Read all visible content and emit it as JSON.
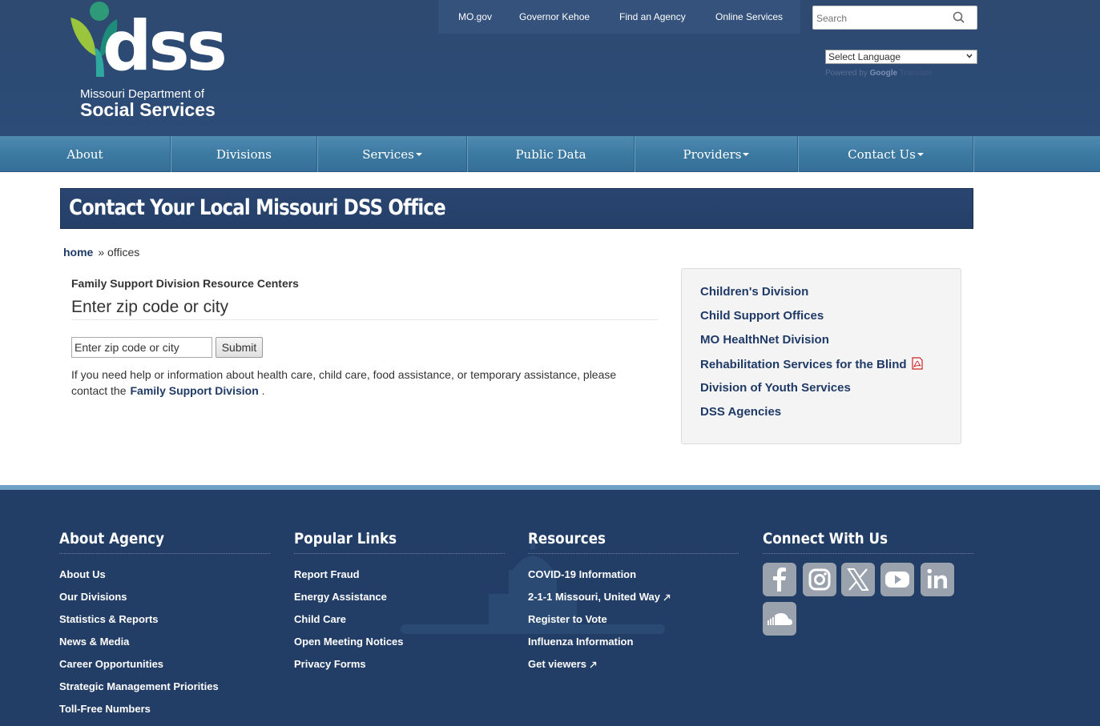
{
  "header": {
    "logo_word": "dss",
    "logo_line1": "Missouri Department of",
    "logo_line2": "Social Services",
    "util_links": [
      "MO.gov",
      "Governor Kehoe",
      "Find an Agency",
      "Online Services"
    ],
    "search_placeholder": "Search",
    "language_select": "Select Language",
    "powered_by": "Powered by",
    "powered_brand": "Google",
    "powered_suffix": "Translate"
  },
  "nav": {
    "items": [
      {
        "label": "About",
        "dropdown": false
      },
      {
        "label": "Divisions",
        "dropdown": false
      },
      {
        "label": "Services",
        "dropdown": true
      },
      {
        "label": "Public Data",
        "dropdown": false
      },
      {
        "label": "Providers",
        "dropdown": true
      },
      {
        "label": "Contact Us",
        "dropdown": true
      }
    ]
  },
  "page": {
    "title": "Contact Your Local Missouri DSS Office",
    "breadcrumb_home": "home",
    "breadcrumb_current": "» offices"
  },
  "main": {
    "section_title": "Family Support Division Resource Centers",
    "zip_heading": "Enter zip code or city",
    "zip_input_value": "Enter zip code or city",
    "submit_label": "Submit",
    "help_text": "If you need help or information about health care, child care, food assistance, or temporary assistance, please contact the",
    "help_link": "Family Support Division",
    "help_end": "."
  },
  "sidebox": {
    "links": [
      "Children's Division",
      "Child Support Offices",
      "MO HealthNet Division",
      "Rehabilitation Services for the Blind",
      "Division of Youth Services",
      "DSS Agencies"
    ]
  },
  "footer": {
    "about": {
      "heading": "About Agency",
      "links": [
        "About Us",
        "Our Divisions",
        "Statistics & Reports",
        "News & Media",
        "Career Opportunities",
        "Strategic Management Priorities",
        "Toll-Free Numbers"
      ]
    },
    "popular": {
      "heading": "Popular Links",
      "links": [
        "Report Fraud",
        "Energy Assistance",
        "Child Care",
        "Open Meeting Notices",
        "Privacy Forms"
      ]
    },
    "resources": {
      "heading": "Resources",
      "links": [
        "COVID-19 Information",
        "2-1-1 Missouri, United Way",
        "Register to Vote",
        "Influenza Information",
        "Get viewers"
      ]
    },
    "connect": {
      "heading": "Connect With Us",
      "icons": [
        "facebook-icon",
        "instagram-icon",
        "x-icon",
        "youtube-icon",
        "linkedin-icon",
        "soundcloud-icon"
      ]
    }
  },
  "colors": {
    "header_bg": "#2b4a74",
    "nav_bg": "#3d7aa2",
    "banner_bg": "#243f68",
    "footer_bg": "#233e66",
    "link": "#1f3a66"
  }
}
